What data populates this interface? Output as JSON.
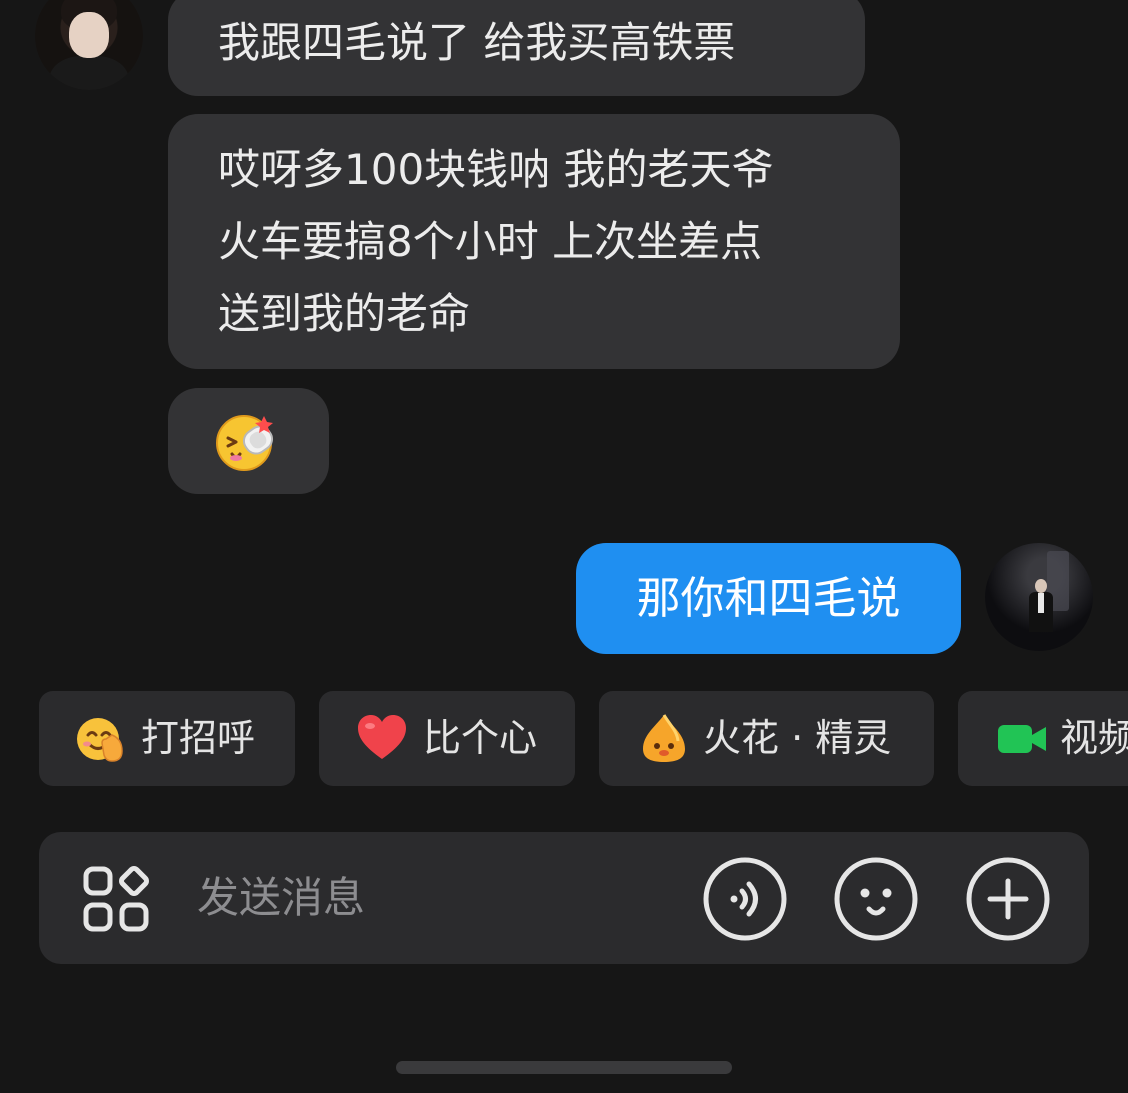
{
  "messages": [
    {
      "side": "left",
      "text": "我跟四毛说了 给我买高铁票"
    },
    {
      "side": "left",
      "lines": [
        "哎呀多100块钱呐 我的老天爷",
        "火车要搞8个小时 上次坐差点",
        "送到我的老命"
      ]
    },
    {
      "side": "left",
      "sticker": "slipper-slap-emoji"
    },
    {
      "side": "right",
      "text": "那你和四毛说"
    }
  ],
  "quick_actions": [
    {
      "label": "打招呼",
      "icon": "wave-smile-icon"
    },
    {
      "label": "比个心",
      "icon": "heart-icon"
    },
    {
      "label": "火花 · 精灵",
      "icon": "spark-spirit-icon"
    },
    {
      "label": "视频",
      "icon": "video-camera-icon"
    }
  ],
  "composer": {
    "placeholder": "发送消息",
    "icons": [
      "apps-icon",
      "voice-icon",
      "emoji-icon",
      "plus-icon"
    ]
  },
  "colors": {
    "background": "#161616",
    "bubble_incoming": "#333335",
    "bubble_outgoing": "#1f8ff1",
    "chip": "#2b2b2d"
  }
}
